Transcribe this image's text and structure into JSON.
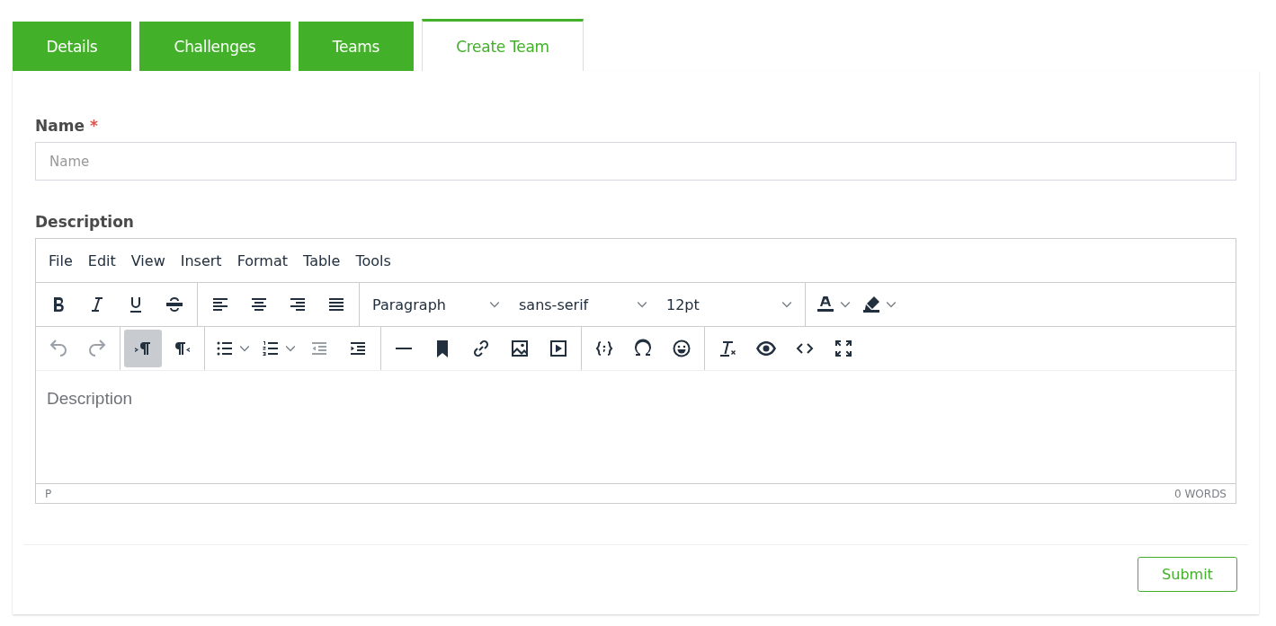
{
  "tabs": [
    {
      "label": "Details",
      "selected": false
    },
    {
      "label": "Challenges",
      "selected": false
    },
    {
      "label": "Teams",
      "selected": false
    },
    {
      "label": "Create Team",
      "selected": true
    }
  ],
  "name_field": {
    "label": "Name",
    "required_mark": "*",
    "placeholder": "Name"
  },
  "description": {
    "label": "Description",
    "editor": {
      "menu": [
        "File",
        "Edit",
        "View",
        "Insert",
        "Format",
        "Table",
        "Tools"
      ],
      "toolbar_rows": [
        [
          [
            {
              "kind": "bold",
              "on": false,
              "disabled": false
            },
            {
              "kind": "italic",
              "on": false,
              "disabled": false
            },
            {
              "kind": "underline",
              "on": false,
              "disabled": false
            },
            {
              "kind": "strikethrough",
              "on": false,
              "disabled": false
            }
          ],
          [
            {
              "kind": "align-left",
              "on": false,
              "disabled": false
            },
            {
              "kind": "align-center",
              "on": false,
              "disabled": false
            },
            {
              "kind": "align-right",
              "on": false,
              "disabled": false
            },
            {
              "kind": "justify",
              "on": false,
              "disabled": false
            }
          ],
          [
            {
              "kind": "select",
              "value": "Paragraph"
            },
            {
              "kind": "select",
              "value": "sans-serif"
            },
            {
              "kind": "select",
              "value": "12pt"
            }
          ],
          [
            {
              "kind": "text-color",
              "split": true,
              "on": false,
              "disabled": false
            },
            {
              "kind": "highlight",
              "split": true,
              "on": false,
              "disabled": false
            }
          ]
        ],
        [
          [
            {
              "kind": "undo",
              "on": false,
              "disabled": true
            },
            {
              "kind": "redo",
              "on": false,
              "disabled": true
            }
          ],
          [
            {
              "kind": "ltr",
              "on": true,
              "disabled": false
            },
            {
              "kind": "rtl",
              "on": false,
              "disabled": false
            }
          ],
          [
            {
              "kind": "bullet-list",
              "split": true,
              "on": false,
              "disabled": false
            },
            {
              "kind": "numbered-list",
              "split": true,
              "on": false,
              "disabled": false
            },
            {
              "kind": "outdent",
              "on": false,
              "disabled": true
            },
            {
              "kind": "indent",
              "on": false,
              "disabled": false
            }
          ],
          [
            {
              "kind": "horizontal-line",
              "on": false,
              "disabled": false
            },
            {
              "kind": "bookmark",
              "on": false,
              "disabled": false
            },
            {
              "kind": "link",
              "on": false,
              "disabled": false
            },
            {
              "kind": "image",
              "on": false,
              "disabled": false
            },
            {
              "kind": "media",
              "on": false,
              "disabled": false
            }
          ],
          [
            {
              "kind": "code-sample",
              "on": false,
              "disabled": false
            },
            {
              "kind": "omega",
              "on": false,
              "disabled": false
            },
            {
              "kind": "emoji",
              "on": false,
              "disabled": false
            }
          ],
          [
            {
              "kind": "clear-format",
              "on": false,
              "disabled": false
            },
            {
              "kind": "preview",
              "on": false,
              "disabled": false
            },
            {
              "kind": "source-code",
              "on": false,
              "disabled": false
            },
            {
              "kind": "fullscreen",
              "on": false,
              "disabled": false
            }
          ]
        ]
      ],
      "placeholder": "Description",
      "status_path": "P",
      "word_count": "0 WORDS"
    }
  },
  "submit": "Submit"
}
